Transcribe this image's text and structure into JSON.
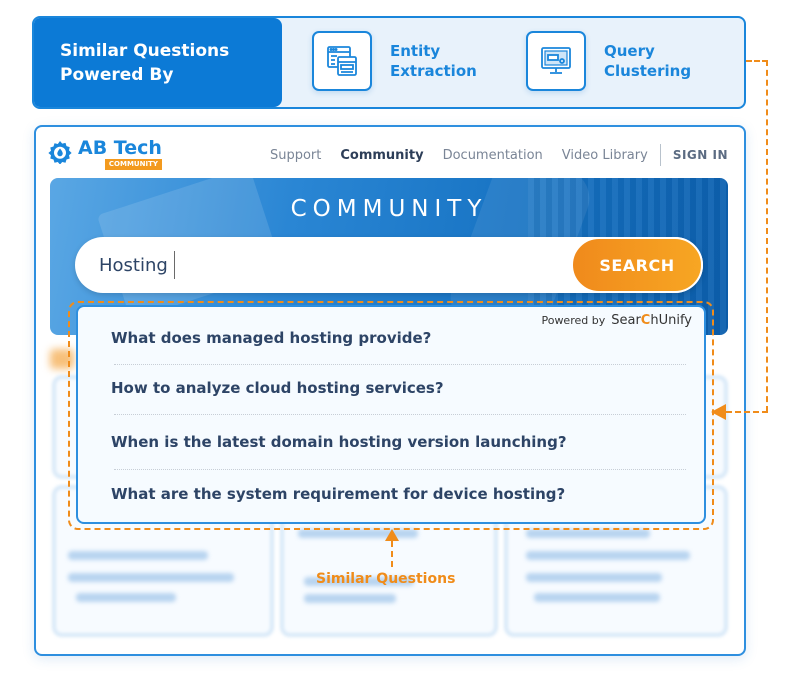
{
  "banner": {
    "title": "Similar Questions\nPowered By",
    "features": [
      {
        "icon": "entity-extraction-icon",
        "label": "Entity\nExtraction"
      },
      {
        "icon": "query-clustering-icon",
        "label": "Query\nClustering"
      }
    ]
  },
  "site": {
    "logo": {
      "name": "AB Tech",
      "badge": "COMMUNITY"
    },
    "nav": {
      "items": [
        "Support",
        "Community",
        "Documentation",
        "Video Library"
      ],
      "active": "Community",
      "sign_in": "SIGN IN"
    },
    "hero": {
      "title": "COMMUNITY"
    },
    "search": {
      "value": "Hosting",
      "button": "SEARCH"
    },
    "dropdown": {
      "powered_by": "Powered by",
      "brand_prefix": "Sear",
      "brand_c": "C",
      "brand_suffix": "hUnify",
      "questions": [
        "What does managed hosting provide?",
        "How to analyze cloud hosting services?",
        "When is the latest domain hosting version launching?",
        "What are the system requirement for device hosting?"
      ]
    }
  },
  "annotation": {
    "label": "Similar Questions"
  },
  "colors": {
    "brand_blue": "#0c7ad6",
    "accent_orange": "#f08c1a",
    "text_dark": "#2d4466"
  }
}
